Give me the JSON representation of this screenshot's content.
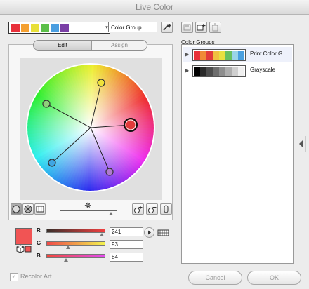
{
  "window": {
    "title": "Live Color"
  },
  "top": {
    "swatches": [
      "#e8303a",
      "#f4a030",
      "#e8df38",
      "#5bbf48",
      "#4a9ee0",
      "#7a3fa5"
    ],
    "group_name": "Color Group",
    "dropdown_icon": "chevron-down-icon",
    "eyedropper_icon": "eyedropper-icon"
  },
  "top_right_icons": [
    "save-icon",
    "new-group-icon",
    "trash-icon"
  ],
  "tabs": {
    "edit": "Edit",
    "assign": "Assign"
  },
  "wheel": {
    "handles": [
      {
        "name": "yellow-handle",
        "color": "#eee23a"
      },
      {
        "name": "green-handle",
        "color": "#8fd07a"
      },
      {
        "name": "red-base-handle",
        "color": "#e23b3b"
      },
      {
        "name": "blue-handle",
        "color": "#3fa6e2"
      },
      {
        "name": "violet-handle",
        "color": "#b07ad0"
      }
    ]
  },
  "color_groups": {
    "title": "Color Groups",
    "items": [
      {
        "name": "Print Color G...",
        "colors": [
          "#e8303a",
          "#f08a36",
          "#e23b3b",
          "#f0c040",
          "#e8e040",
          "#67c060",
          "#9ad4e8",
          "#4aa0e0"
        ]
      },
      {
        "name": "Grayscale",
        "colors": [
          "#000000",
          "#2a2a2a",
          "#4d4d4d",
          "#6e6e6e",
          "#8e8e8e",
          "#aeaeae",
          "#cfcfcf",
          "#efefef"
        ]
      }
    ]
  },
  "rgb": {
    "swatch_color": "#f15454",
    "r_label": "R",
    "r_value": "241",
    "g_label": "G",
    "g_value": "93",
    "b_label": "B",
    "b_value": "84",
    "r_level": 0.945,
    "g_level": 0.365,
    "b_level": 0.33
  },
  "bottom": {
    "recolor_label": "Recolor Art",
    "cancel": "Cancel",
    "ok": "OK"
  }
}
